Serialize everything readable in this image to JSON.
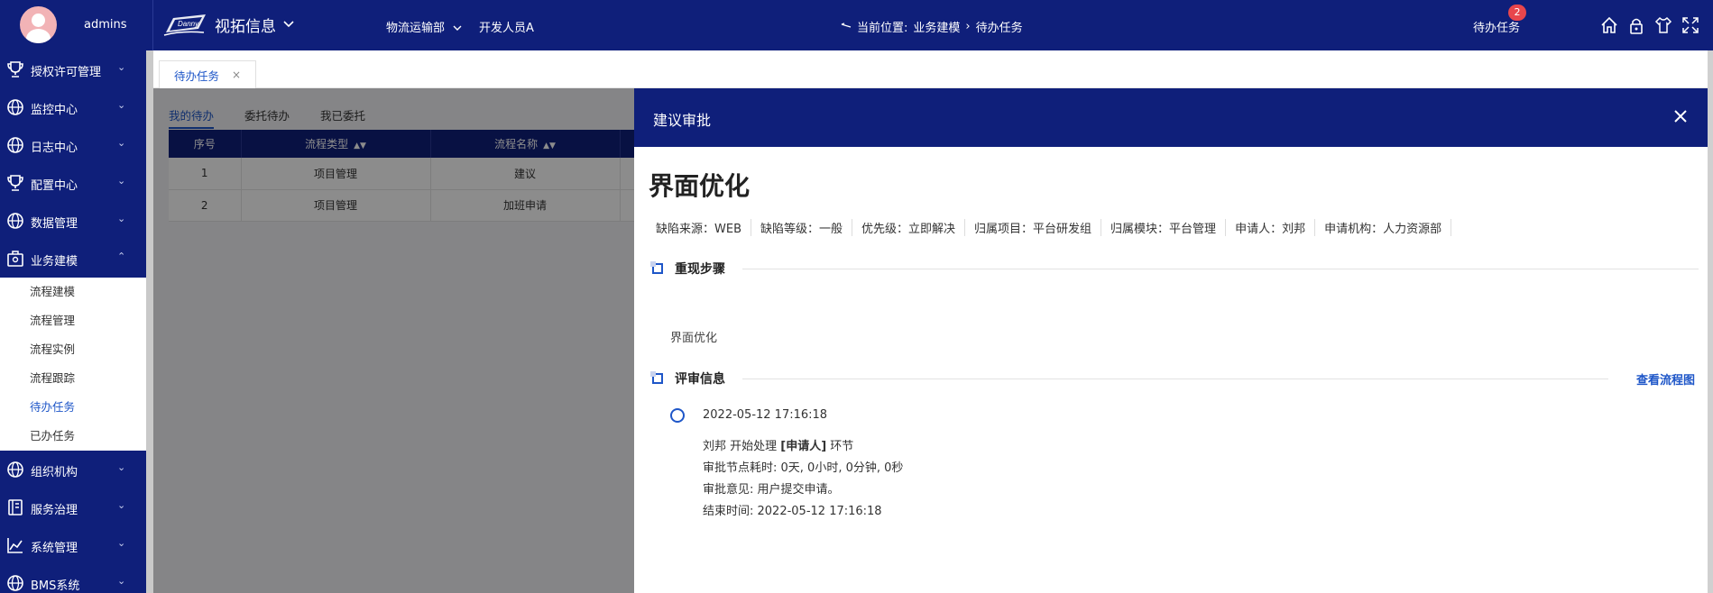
{
  "header": {
    "username": "admins",
    "brand_name": "视拓信息",
    "nav": [
      "物流运输部",
      "开发人员A"
    ],
    "location_label": "当前位置:",
    "location_path": [
      "业务建模",
      "待办任务"
    ],
    "todo_label": "待办任务",
    "todo_badge": "2",
    "toolbar_icons": [
      "home-icon",
      "lock-icon",
      "shirt-icon",
      "fullscreen-icon"
    ]
  },
  "sidebar": {
    "items": [
      {
        "label": "授权许可管理",
        "icon": "trophy-icon"
      },
      {
        "label": "监控中心",
        "icon": "globe-icon"
      },
      {
        "label": "日志中心",
        "icon": "globe-icon"
      },
      {
        "label": "配置中心",
        "icon": "trophy-icon"
      },
      {
        "label": "数据管理",
        "icon": "globe-icon"
      },
      {
        "label": "业务建模",
        "icon": "toolbox-icon",
        "expanded": true
      }
    ],
    "submenu": [
      {
        "label": "流程建模"
      },
      {
        "label": "流程管理"
      },
      {
        "label": "流程实例"
      },
      {
        "label": "流程跟踪"
      },
      {
        "label": "待办任务",
        "active": true
      },
      {
        "label": "已办任务"
      }
    ],
    "items_after": [
      {
        "label": "组织机构",
        "icon": "globe-icon"
      },
      {
        "label": "服务治理",
        "icon": "panel-icon"
      },
      {
        "label": "系统管理",
        "icon": "chart-line-icon"
      },
      {
        "label": "BMS系统",
        "icon": "globe-icon"
      }
    ]
  },
  "tabs": [
    {
      "label": "待办任务"
    }
  ],
  "subtabs": [
    {
      "label": "我的待办",
      "active": true
    },
    {
      "label": "委托待办"
    },
    {
      "label": "我已委托"
    }
  ],
  "table": {
    "columns": [
      "序号",
      "流程类型",
      "流程名称"
    ],
    "rows": [
      [
        "1",
        "项目管理",
        "建议"
      ],
      [
        "2",
        "项目管理",
        "加班申请"
      ]
    ]
  },
  "drawer": {
    "title": "建议审批",
    "heading": "界面优化",
    "meta": [
      "缺陷来源：WEB",
      "缺陷等级：一般",
      "优先级：立即解决",
      "归属项目：平台研发组",
      "归属模块：平台管理",
      "申请人：刘邦",
      "申请机构：人力资源部"
    ],
    "steps_title": "重现步骤",
    "steps_text": "界面优化",
    "review_title": "评审信息",
    "review_link": "查看流程图",
    "timeline": {
      "time": "2022-05-12 17:16:18",
      "line1_pre": "刘邦 开始处理 ",
      "line1_bold": "[申请人]",
      "line1_post": " 环节",
      "line2": "审批节点耗时:   0天, 0小时, 0分钟, 0秒",
      "line3": "审批意见:  用户提交申请。",
      "line4": "结束时间:  2022-05-12 17:16:18"
    }
  },
  "colors": {
    "primary": "#0f1f7a",
    "accent": "#1e56c8",
    "badge": "#e8464c"
  }
}
